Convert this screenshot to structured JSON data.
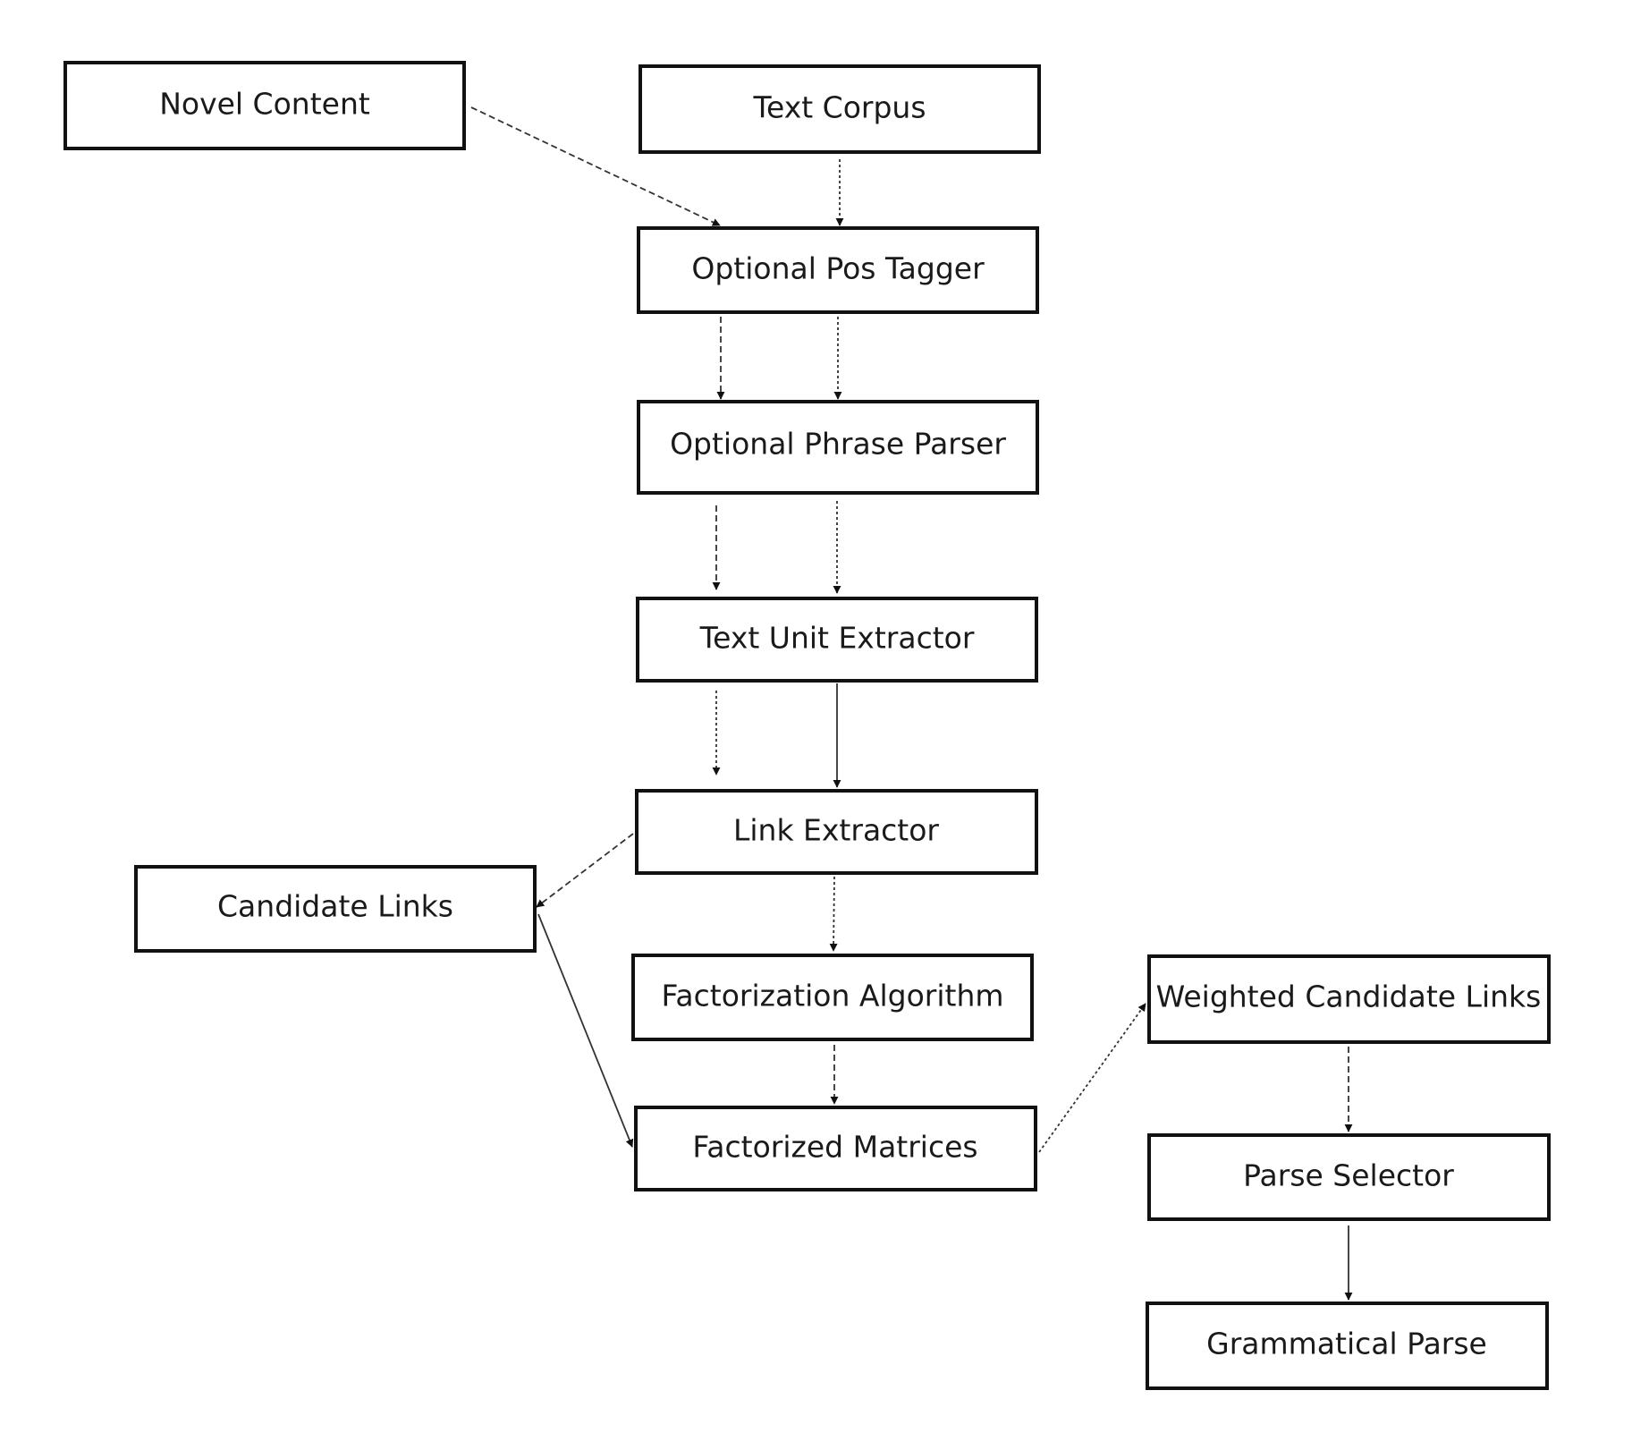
{
  "diagram": {
    "type": "flowchart",
    "nodes": [
      {
        "id": "novel_content",
        "label": "Novel Content"
      },
      {
        "id": "text_corpus",
        "label": "Text Corpus"
      },
      {
        "id": "pos_tagger",
        "label": "Optional Pos Tagger"
      },
      {
        "id": "phrase_parser",
        "label": "Optional Phrase Parser"
      },
      {
        "id": "text_unit_extractor",
        "label": "Text Unit Extractor"
      },
      {
        "id": "link_extractor",
        "label": "Link Extractor"
      },
      {
        "id": "candidate_links",
        "label": "Candidate Links"
      },
      {
        "id": "factorization_algorithm",
        "label": "Factorization Algorithm"
      },
      {
        "id": "factorized_matrices",
        "label": "Factorized Matrices"
      },
      {
        "id": "weighted_candidate_links",
        "label": "Weighted Candidate Links"
      },
      {
        "id": "parse_selector",
        "label": "Parse Selector"
      },
      {
        "id": "grammatical_parse",
        "label": "Grammatical Parse"
      }
    ],
    "edges": [
      {
        "from": "novel_content",
        "to": "pos_tagger",
        "style": "dashed"
      },
      {
        "from": "text_corpus",
        "to": "pos_tagger",
        "style": "dotted"
      },
      {
        "from": "pos_tagger",
        "to": "phrase_parser",
        "style": "dashed",
        "lane": "novel"
      },
      {
        "from": "pos_tagger",
        "to": "phrase_parser",
        "style": "dotted",
        "lane": "corpus"
      },
      {
        "from": "phrase_parser",
        "to": "text_unit_extractor",
        "style": "dashed",
        "lane": "novel"
      },
      {
        "from": "phrase_parser",
        "to": "text_unit_extractor",
        "style": "dotted",
        "lane": "corpus"
      },
      {
        "from": "text_unit_extractor",
        "to": "link_extractor",
        "style": "dotted",
        "lane": "novel"
      },
      {
        "from": "text_unit_extractor",
        "to": "link_extractor",
        "style": "solid",
        "lane": "corpus"
      },
      {
        "from": "link_extractor",
        "to": "candidate_links",
        "style": "dashed"
      },
      {
        "from": "link_extractor",
        "to": "factorization_algorithm",
        "style": "dotted"
      },
      {
        "from": "candidate_links",
        "to": "factorized_matrices",
        "style": "solid"
      },
      {
        "from": "factorization_algorithm",
        "to": "factorized_matrices",
        "style": "dashed"
      },
      {
        "from": "factorized_matrices",
        "to": "weighted_candidate_links",
        "style": "dotted"
      },
      {
        "from": "weighted_candidate_links",
        "to": "parse_selector",
        "style": "dashed"
      },
      {
        "from": "parse_selector",
        "to": "grammatical_parse",
        "style": "solid"
      }
    ]
  }
}
